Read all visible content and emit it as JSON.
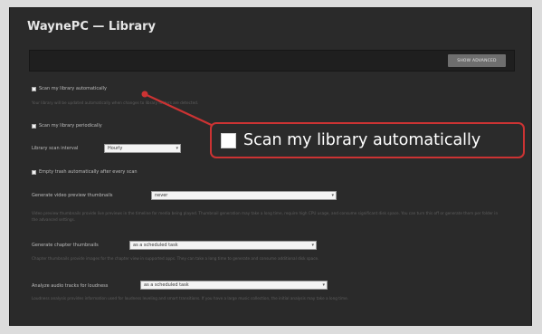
{
  "window": {
    "title": "WaynePC — Library"
  },
  "toolbar": {
    "button_label": "Show Advanced"
  },
  "settings": {
    "scan_auto": {
      "label": "Scan my library automatically",
      "checked": true
    },
    "scan_auto_desc": "Your library will be updated automatically when changes to library folders are detected.",
    "scan_periodic": {
      "label": "Scan my library periodically",
      "checked": true
    },
    "scan_interval": {
      "label": "Library scan interval",
      "value": "Hourly"
    },
    "empty_trash": {
      "label": "Empty trash automatically after every scan",
      "checked": true
    },
    "video_thumbs": {
      "label": "Generate video preview thumbnails",
      "value": "never",
      "desc": "Video preview thumbnails provide live previews in the timeline for media being played. Thumbnail generation may take a long time, require high CPU usage, and consume significant disk space. You can turn this off or generate them per folder in the advanced settings."
    },
    "chapter_thumbs": {
      "label": "Generate chapter thumbnails",
      "value": "as a scheduled task",
      "desc": "Chapter thumbnails provide images for the chapter view in supported apps. They can take a long time to generate and consume additional disk space."
    },
    "loudness": {
      "label": "Analyze audio tracks for loudness",
      "value": "as a scheduled task",
      "desc": "Loudness analysis provides information used for loudness leveling and smart transitions. If you have a large music collection, the initial analysis may take a long time."
    }
  },
  "callout": {
    "text": "Scan my library automatically"
  },
  "colors": {
    "accent_red": "#cc3333",
    "panel_bg": "#2a2a2a"
  }
}
